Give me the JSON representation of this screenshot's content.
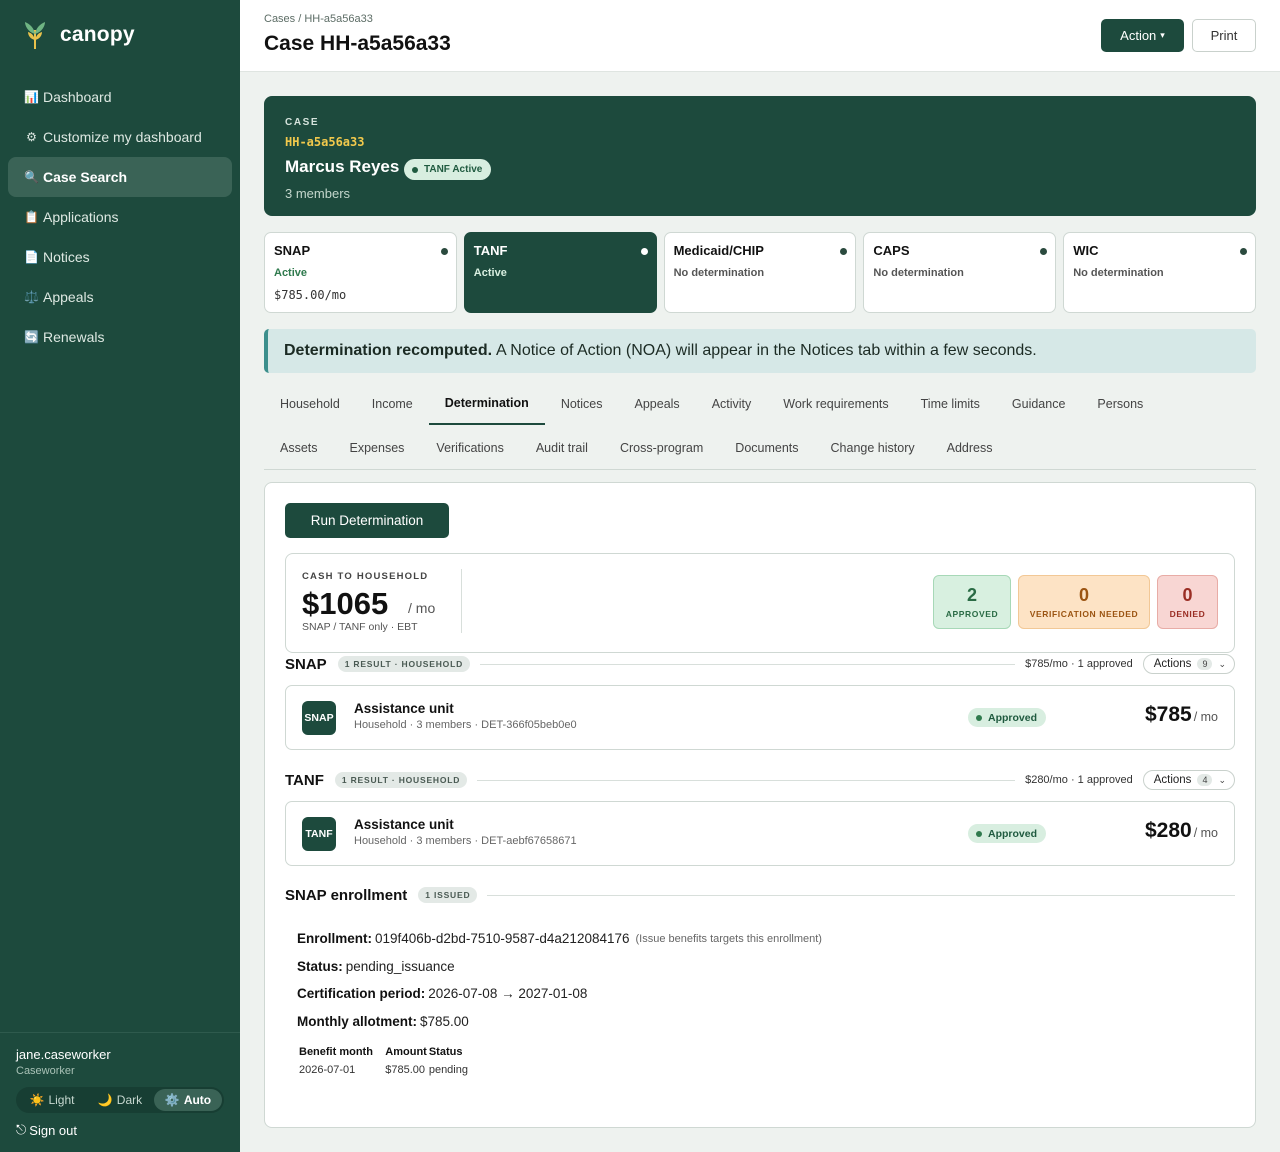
{
  "brand": {
    "name": "canopy"
  },
  "sidebar": {
    "items": [
      {
        "icon": "📊",
        "icon_name": "chart-icon",
        "label": "Dashboard"
      },
      {
        "icon": "⚙",
        "icon_name": "gear-icon",
        "label": "Customize my dashboard"
      },
      {
        "icon": "🔍",
        "icon_name": "search-icon",
        "label": "Case Search",
        "active": true
      },
      {
        "icon": "📋",
        "icon_name": "clipboard-icon",
        "label": "Applications"
      },
      {
        "icon": "📄",
        "icon_name": "document-icon",
        "label": "Notices"
      },
      {
        "icon": "⚖️",
        "icon_name": "scales-icon",
        "label": "Appeals"
      },
      {
        "icon": "🔄",
        "icon_name": "refresh-icon",
        "label": "Renewals"
      }
    ],
    "user": {
      "name": "jane.caseworker",
      "role": "Caseworker"
    },
    "theme": {
      "light": "Light",
      "dark": "Dark",
      "auto": "Auto",
      "light_icon": "☀️",
      "dark_icon": "🌙",
      "auto_icon": "⚙️",
      "selected": "Auto"
    },
    "signout": {
      "icon": "⎋",
      "label": "Sign out"
    }
  },
  "header": {
    "breadcrumb": "Cases / HH-a5a56a33",
    "title": "Case HH-a5a56a33",
    "action_label": "Action",
    "action_caret": "▾",
    "print_label": "Print"
  },
  "case": {
    "label": "CASE",
    "id": "HH-a5a56a33",
    "name": "Marcus Reyes",
    "badge": "TANF Active",
    "members": "3 members"
  },
  "programs": [
    {
      "name": "SNAP",
      "status": "Active",
      "amount": "$785.00/mo",
      "active": false
    },
    {
      "name": "TANF",
      "status": "Active",
      "amount": "",
      "active": true
    },
    {
      "name": "Medicaid/CHIP",
      "status": "No determination",
      "amount": "",
      "active": false
    },
    {
      "name": "CAPS",
      "status": "No determination",
      "amount": "",
      "active": false
    },
    {
      "name": "WIC",
      "status": "No determination",
      "amount": "",
      "active": false
    }
  ],
  "alert": {
    "bold": "Determination recomputed.",
    "text": "A Notice of Action (NOA) will appear in the Notices tab within a few seconds."
  },
  "tabs": {
    "row1": [
      "Household",
      "Income",
      "Determination",
      "Notices",
      "Appeals",
      "Activity",
      "Work requirements",
      "Time limits",
      "Guidance",
      "Persons"
    ],
    "row2": [
      "Assets",
      "Expenses",
      "Verifications",
      "Audit trail",
      "Cross-program",
      "Documents",
      "Change history",
      "Address"
    ],
    "active": "Determination"
  },
  "determination": {
    "run_label": "Run Determination",
    "summary": {
      "label": "CASH TO HOUSEHOLD",
      "amount": "$1065",
      "unit": "/ mo",
      "note": "SNAP / TANF only · EBT",
      "approved": {
        "count": "2",
        "label": "APPROVED"
      },
      "verification": {
        "count": "0",
        "label": "VERIFICATION NEEDED"
      },
      "denied": {
        "count": "0",
        "label": "DENIED"
      }
    },
    "sections": [
      {
        "title": "SNAP",
        "chip": "1 RESULT · HOUSEHOLD",
        "summary": "$785/mo · 1 approved",
        "actions_label": "Actions",
        "actions_count": "9",
        "unit": {
          "icon": "SNAP",
          "title": "Assistance unit",
          "sub": "Household · 3 members · DET-366f05beb0e0",
          "badge": "Approved",
          "amount": "$785",
          "per": "/ mo"
        }
      },
      {
        "title": "TANF",
        "chip": "1 RESULT · HOUSEHOLD",
        "summary": "$280/mo · 1 approved",
        "actions_label": "Actions",
        "actions_count": "4",
        "unit": {
          "icon": "TANF",
          "title": "Assistance unit",
          "sub": "Household · 3 members · DET-aebf67658671",
          "badge": "Approved",
          "amount": "$280",
          "per": "/ mo"
        }
      }
    ],
    "enrollment": {
      "title": "SNAP enrollment",
      "chip": "1 ISSUED",
      "enrollment_label": "Enrollment:",
      "enrollment_id": "019f406b-d2bd-7510-9587-d4a212084176",
      "enrollment_hint": "(Issue benefits targets this enrollment)",
      "status_label": "Status:",
      "status": "pending_issuance",
      "cert_label": "Certification period:",
      "cert_period": "2026-07-08 → 2027-01-08",
      "allot_label": "Monthly allotment:",
      "allotment": "$785.00",
      "table": {
        "headers": [
          "Benefit month",
          "Amount",
          "Status"
        ],
        "rows": [
          [
            "2026-07-01",
            "$785.00",
            "pending"
          ]
        ]
      }
    }
  },
  "colors": {
    "brand_green": "#1d4a3d",
    "accent_gold": "#f2c94c",
    "approved": "#d8f0e0",
    "verification": "#fde3c5",
    "denied": "#f8d6d3"
  }
}
